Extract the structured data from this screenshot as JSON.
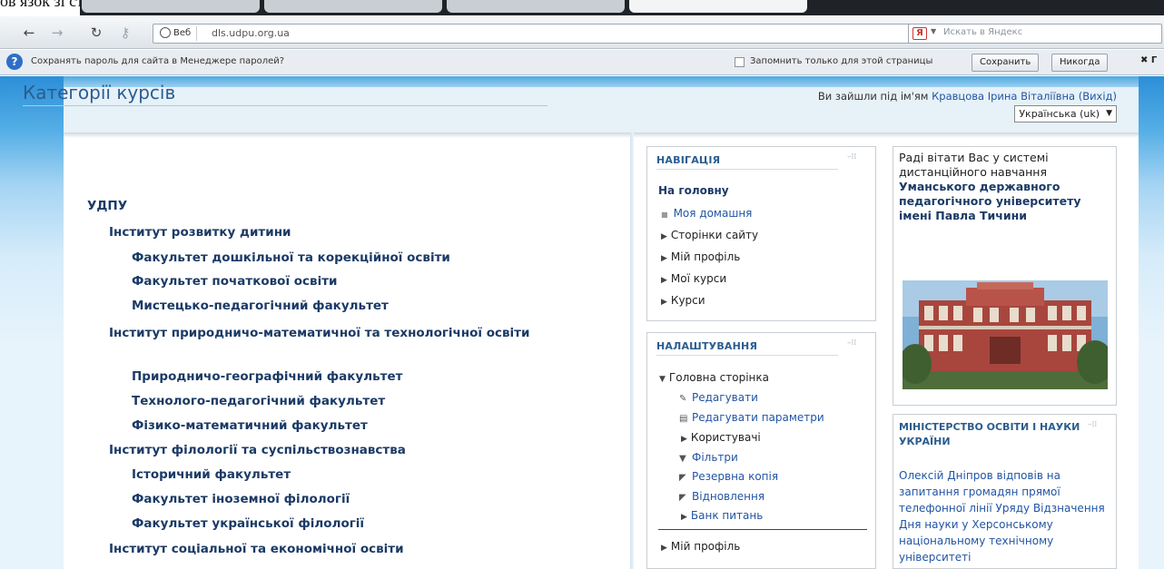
{
  "doc_fragment": "ов язок зі студентами.",
  "toolbar": {
    "back": "←",
    "forward": "→",
    "reload": "↻",
    "key": "⚷",
    "url_badge": "Веб",
    "url": "dls.udpu.org.ua",
    "star": "★",
    "yandex_logo": "Я",
    "yandex_placeholder": "Искать в Яндекс"
  },
  "password_bar": {
    "icon": "?",
    "message": "Сохранять пароль для сайта в Менеджере паролей?",
    "only_this_page": "Запомнить только для этой страницы",
    "save": "Сохранить",
    "never": "Никогда",
    "close": "✖ Г"
  },
  "header": {
    "login_prefix": "Ви зайшли під ім'ям",
    "user_name": "Кравцова Ірина Віталіївна",
    "logout": "(Вихід)",
    "language": "Українська (uk)"
  },
  "categories": {
    "title": "Категорії курсів",
    "root": "УДПУ",
    "items": [
      "Інститут розвитку дитини",
      "Факультет дошкільної та корекційної освіти",
      "Факультет початкової освіти",
      "Мистецько-педагогічний факультет",
      "Інститут природничо-математичної та технологічної освіти",
      "Природничо-географічний факультет",
      "Технолого-педагогічний факультет",
      "Фізико-математичний факультет",
      "Інститут філології та суспільствознавства",
      "Історичний факультет",
      "Факультет іноземної філології",
      "Факультет української філології",
      "Інститут соціальної та економічної освіти"
    ]
  },
  "navigation": {
    "title": "НАВІГАЦІЯ",
    "home": "На головну",
    "items": [
      "Моя домашня",
      "Сторінки сайту",
      "Мій профіль",
      "Мої курси",
      "Курси"
    ]
  },
  "settings": {
    "title": "НАЛАШТУВАННЯ",
    "home_page": "Головна сторінка",
    "items": [
      "Редагувати",
      "Редагувати параметри",
      "Користувачі",
      "Фільтри",
      "Резервна копія",
      "Відновлення",
      "Банк питань"
    ],
    "my_profile": "Мій профіль"
  },
  "welcome": {
    "text_plain": "Раді вітати Вас у системі дистанційного навчання",
    "text_bold": "Уманського державного педагогічного університету імені Павла Тичини"
  },
  "news": {
    "title": "МІНІСТЕРСТВО ОСВІТИ І НАУКИ УКРАЇНИ",
    "text": "Олексій Дніпров відповів на запитання громадян прямої телефонної лінії Уряду Відзначення Дня науки у Херсонському національному технічному університеті"
  },
  "colors": {
    "link": "#2255a4",
    "heading": "#2b5d8f",
    "category": "#1b3a66"
  }
}
